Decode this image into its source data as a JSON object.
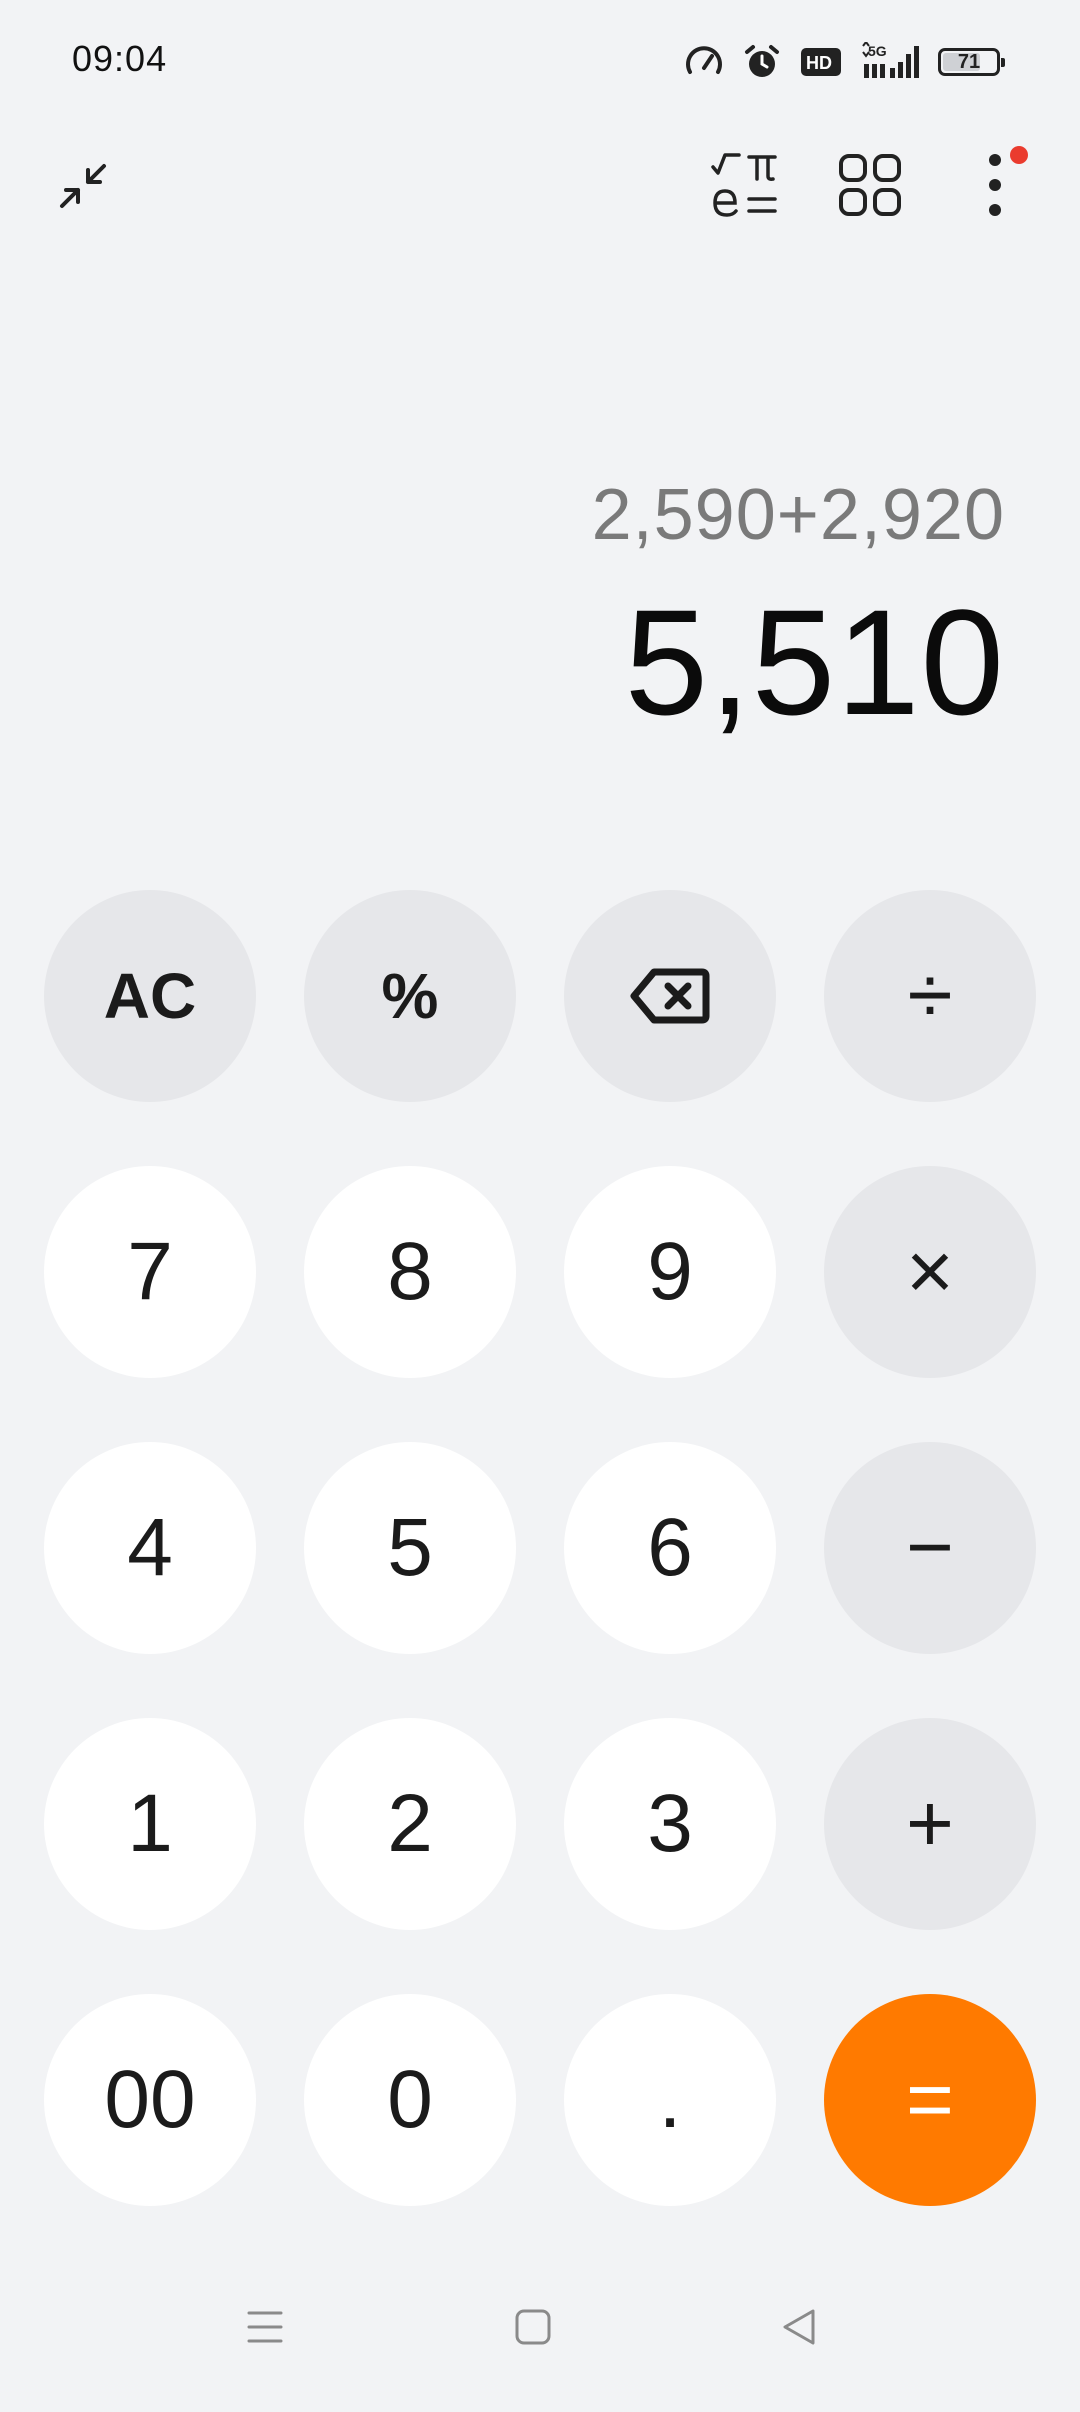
{
  "status_bar": {
    "time": "09:04",
    "network": "5G",
    "hd": "HD",
    "battery_level": 71,
    "battery_text": "71"
  },
  "toolbar": {
    "icons": [
      "minimize-icon",
      "scientific-mode-icon",
      "converter-grid-icon",
      "more-options-icon"
    ],
    "notification_dot_color": "#ea3b2e"
  },
  "display": {
    "expression": "2,590+2,920",
    "result": "5,510"
  },
  "keypad": {
    "ac": "AC",
    "percent": "%",
    "backspace": "backspace-icon",
    "divide": "÷",
    "seven": "7",
    "eight": "8",
    "nine": "9",
    "multiply": "×",
    "four": "4",
    "five": "5",
    "six": "6",
    "minus": "−",
    "one": "1",
    "two": "2",
    "three": "3",
    "plus": "+",
    "double_zero": "00",
    "zero": "0",
    "decimal": ".",
    "equals": "="
  },
  "colors": {
    "background": "#f2f3f5",
    "number_key": "#ffffff",
    "function_key": "#e6e7ea",
    "equals_key": "#ff7a00",
    "expression_text": "#7a7a7a",
    "result_text": "#0b0b0b"
  },
  "nav_bar": {
    "icons": [
      "menu-icon",
      "home-icon",
      "back-icon"
    ]
  }
}
